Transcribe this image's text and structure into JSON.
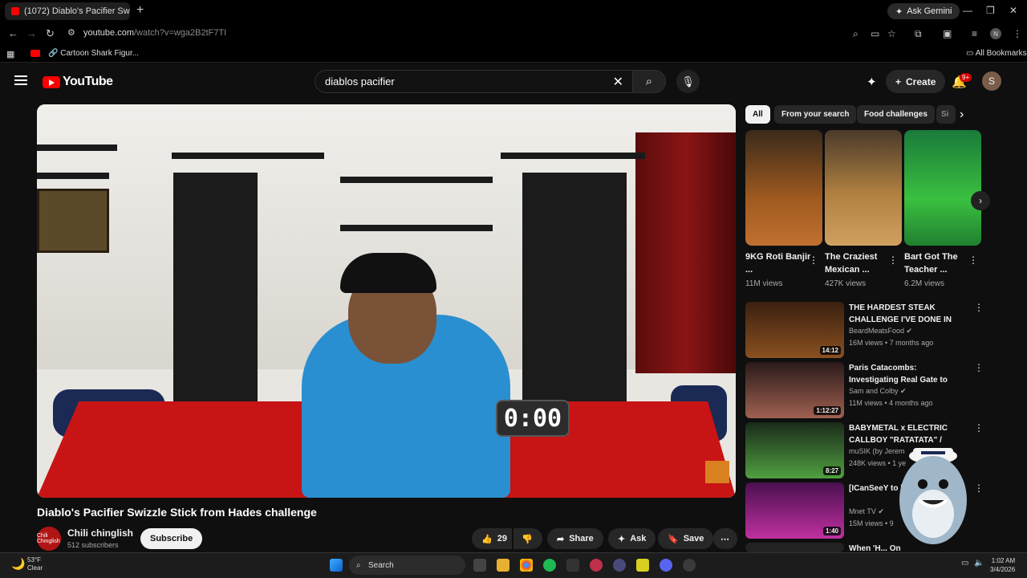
{
  "browser": {
    "tab_title": "(1072) Diablo's Pacifier Swi",
    "new_tab": "+",
    "gemini_label": "Ask Gemini",
    "url_host": "youtube.com",
    "url_path": "/watch?v=wga2B2tF7TI",
    "bookmark_1": "Cartoon Shark Figur...",
    "all_bookmarks": "All Bookmarks",
    "profile_initial": "N"
  },
  "youtube": {
    "logo_text": "YouTube",
    "search_value": "diablos pacifier",
    "create_label": "Create",
    "notif_badge": "9+",
    "avatar_initial": "S"
  },
  "video": {
    "timer_text": "0:00",
    "title": "Diablo's Pacifier Swizzle Stick from Hades challenge",
    "channel_name": "Chili chinglish",
    "channel_subs": "512 subscribers",
    "channel_logo_text": "Chili Chinglish",
    "subscribe_label": "Subscribe",
    "likes": "29",
    "share_label": "Share",
    "ask_label": "Ask",
    "save_label": "Save"
  },
  "chips": [
    "All",
    "From your search",
    "Food challenges",
    "Si"
  ],
  "shorts": [
    {
      "title": "9KG Roti Banjir ...",
      "views": "11M views"
    },
    {
      "title": "The Craziest Mexican ...",
      "views": "427K views"
    },
    {
      "title": "Bart Got The Teacher ...",
      "views": "6.2M views"
    }
  ],
  "recommendations": [
    {
      "title": "THE HARDEST STEAK CHALLENGE I'VE DONE IN ...",
      "channel": "BeardMeatsFood ✔",
      "meta": "16M views • 7 months ago",
      "duration": "14:12"
    },
    {
      "title": "Paris Catacombs: Investigating Real Gate to Hell",
      "channel": "Sam and Colby ✔",
      "meta": "11M views • 4 months ago",
      "duration": "1:12:27"
    },
    {
      "title": "BABYMETAL x ELECTRIC CALLBOY \"RATATATA\" / Audi...",
      "channel": "muSIK (by Jerem",
      "meta": "248K views • 1 ye",
      "duration": "8:27"
    },
    {
      "title": "[ICanSeeY to be in EX",
      "channel": "Mnet TV ✔",
      "meta": "15M views • 9",
      "duration": "1:40"
    },
    {
      "title": "When 'H... On",
      "channel": "",
      "meta": "",
      "duration": ""
    }
  ],
  "taskbar": {
    "temp": "53°F",
    "condition": "Clear",
    "search_label": "Search",
    "time": "1:02 AM",
    "date": "3/4/2026"
  },
  "colors": {
    "accent_red": "#ff0000",
    "bg": "#0f0f0f",
    "chip_active": "#f1f1f1"
  }
}
